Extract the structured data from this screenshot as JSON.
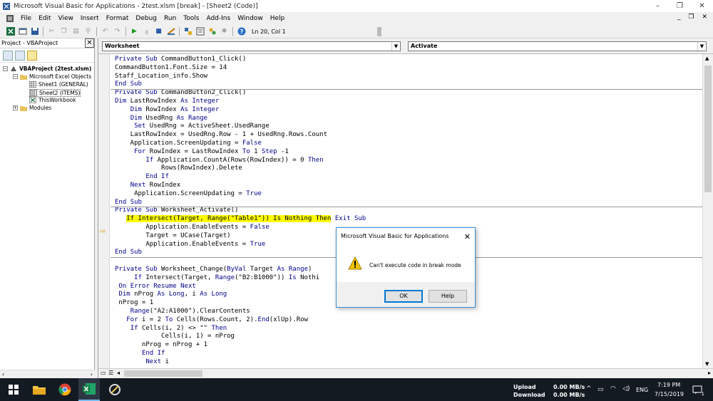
{
  "window": {
    "title": "Microsoft Visual Basic for Applications - 2test.xlsm [break] - [Sheet2 (Code)]",
    "controls": [
      "–",
      "❐",
      "✕"
    ]
  },
  "menubar": {
    "items": [
      "File",
      "Edit",
      "View",
      "Insert",
      "Format",
      "Debug",
      "Run",
      "Tools",
      "Add-Ins",
      "Window",
      "Help"
    ],
    "mdi_controls": "_ ❐ ✕"
  },
  "toolbar": {
    "position": "Ln 20, Col 1"
  },
  "project": {
    "title": "Project - VBAProject",
    "close": "✕",
    "tree": [
      {
        "label": "VBAProject (2test.xlsm)",
        "level": 0,
        "expander": "−",
        "bold": true
      },
      {
        "label": "Microsoft Excel Objects",
        "level": 1,
        "expander": "−"
      },
      {
        "label": "Sheet1 (GENERAL)",
        "level": 2
      },
      {
        "label": "Sheet2 (ITEMS)",
        "level": 2
      },
      {
        "label": "ThisWorkbook",
        "level": 2
      },
      {
        "label": "Modules",
        "level": 1,
        "expander": "+"
      }
    ]
  },
  "code": {
    "object_combo": "Worksheet",
    "proc_combo": "Activate",
    "lines": [
      "Private Sub CommandButton1_Click()",
      "CommandButton1.Font.Size = 14",
      "Staff_Location_info.Show",
      "End Sub",
      "Private Sub CommandButton2_Click()",
      "Dim LastRowIndex As Integer",
      "    Dim RowIndex As Integer",
      "    Dim UsedRng As Range",
      "     Set UsedRng = ActiveSheet.UsedRange",
      "    LastRowIndex = UsedRng.Row - 1 + UsedRng.Rows.Count",
      "    Application.ScreenUpdating = False",
      "     For RowIndex = LastRowIndex To 1 Step -1",
      "        If Application.CountA(Rows(RowIndex)) = 0 Then",
      "            Rows(RowIndex).Delete",
      "        End If",
      "    Next RowIndex",
      "     Application.ScreenUpdating = True",
      "End Sub",
      "Private Sub Worksheet_Activate()",
      "   If Intersect(Target, Range(\"Table1\")) Is Nothing Then Exit Sub",
      "        Application.EnableEvents = False",
      "        Target = UCase(Target)",
      "        Application.EnableEvents = True",
      "End Sub",
      "",
      "Private Sub Worksheet_Change(ByVal Target As Range)",
      "     If Intersect(Target, Range(\"B2:B1000\")) Is Nothi",
      " On Error Resume Next",
      " Dim nProg As Long, i As Long",
      " nProg = 1",
      "    Range(\"A2:A1000\").ClearContents",
      "   For i = 2 To Cells(Rows.Count, 2).End(xlUp).Row",
      "    If Cells(i, 2) <> \"\" Then",
      "            Cells(i, 1) = nProg",
      "       nProg = nProg + 1",
      "       End If",
      "        Next i"
    ],
    "highlight_text": "If Intersect(Target, Range(\"Table1\")) Is Nothing Then",
    "highlight_rest": " Exit Sub"
  },
  "dialog": {
    "title": "Microsoft Visual Basic for Applications",
    "close": "✕",
    "message": "Can't execute code in break mode",
    "ok": "OK",
    "help": "Help"
  },
  "taskbar": {
    "upload_label": "Upload",
    "download_label": "Download",
    "upload_rate": "0.00 MB/s",
    "download_rate": "0.00 MB/s",
    "lang": "ENG",
    "time": "7:19 PM",
    "date": "7/15/2019",
    "notif": "1"
  }
}
